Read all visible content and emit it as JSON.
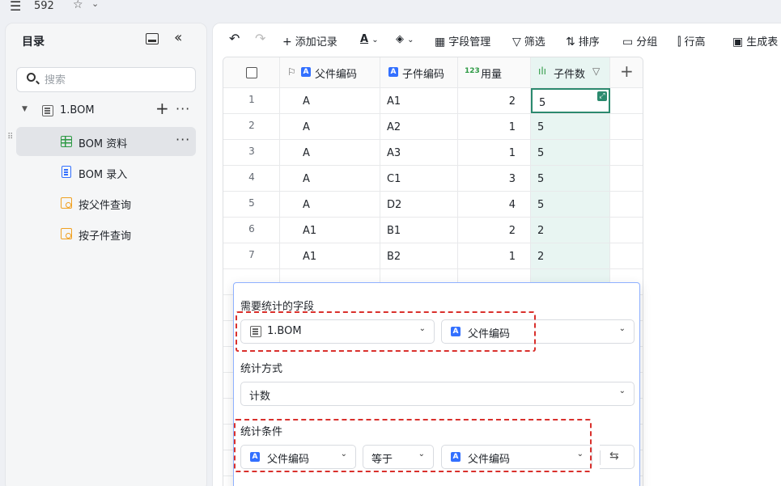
{
  "topbar": {
    "title_num": "592"
  },
  "sidebar": {
    "title": "目录",
    "search_placeholder": "搜索",
    "items": [
      {
        "label": "1.BOM",
        "type": "sheet"
      },
      {
        "label": "BOM 资料",
        "type": "grid"
      },
      {
        "label": "BOM 录入",
        "type": "form"
      },
      {
        "label": "按父件查询",
        "type": "query"
      },
      {
        "label": "按子件查询",
        "type": "query"
      }
    ]
  },
  "toolbar": {
    "add_record": "添加记录",
    "field_manage": "字段管理",
    "filter": "筛选",
    "sort": "排序",
    "group": "分组",
    "row_height": "行高",
    "generate": "生成表"
  },
  "grid": {
    "headers": [
      "父件编码",
      "子件编码",
      "用量",
      "子件数"
    ],
    "rows": [
      {
        "n": "1",
        "parent": "A",
        "child": "A1",
        "qty": "2",
        "count": "5"
      },
      {
        "n": "2",
        "parent": "A",
        "child": "A2",
        "qty": "1",
        "count": "5"
      },
      {
        "n": "3",
        "parent": "A",
        "child": "A3",
        "qty": "1",
        "count": "5"
      },
      {
        "n": "4",
        "parent": "A",
        "child": "C1",
        "qty": "3",
        "count": "5"
      },
      {
        "n": "5",
        "parent": "A",
        "child": "D2",
        "qty": "4",
        "count": "5"
      },
      {
        "n": "6",
        "parent": "A1",
        "child": "B1",
        "qty": "2",
        "count": "2"
      },
      {
        "n": "7",
        "parent": "A1",
        "child": "B2",
        "qty": "1",
        "count": "2"
      }
    ]
  },
  "popup": {
    "field_label": "需要统计的字段",
    "field_table": "1.BOM",
    "field_column": "父件编码",
    "method_label": "统计方式",
    "method_value": "计数",
    "condition_label": "统计条件",
    "cond_field": "父件编码",
    "cond_op": "等于",
    "cond_value": "父件编码"
  }
}
